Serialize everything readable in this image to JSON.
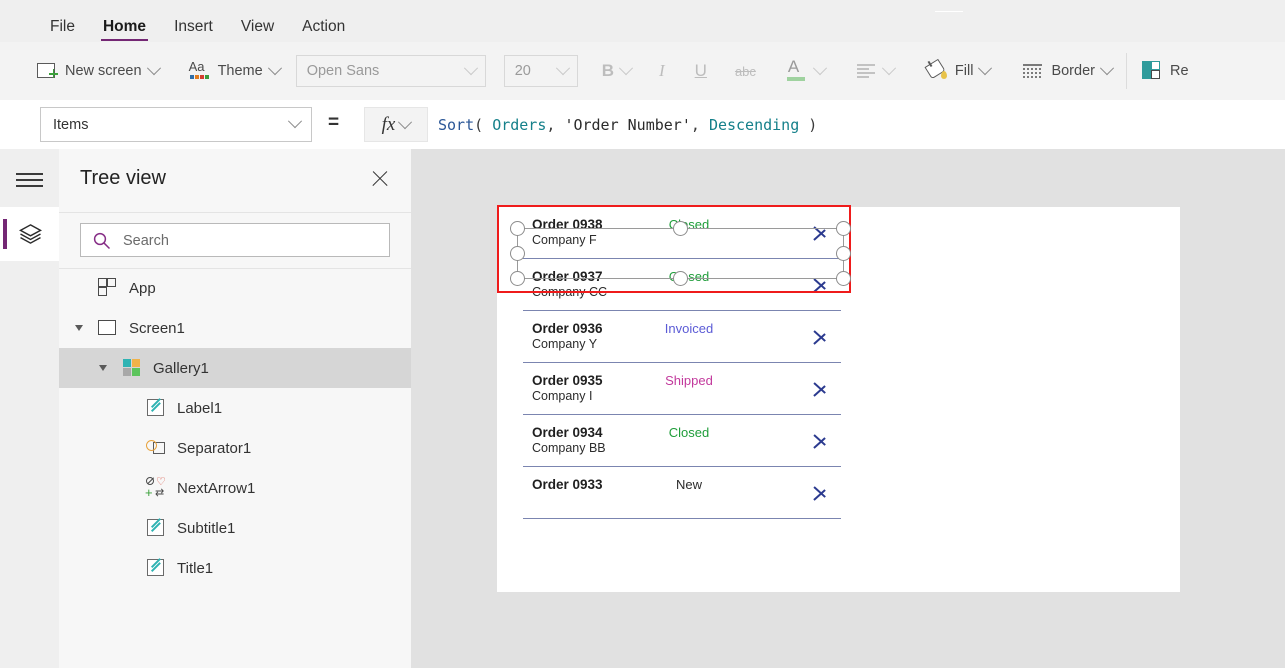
{
  "menubar": {
    "items": [
      {
        "label": "File",
        "active": false
      },
      {
        "label": "Home",
        "active": true
      },
      {
        "label": "Insert",
        "active": false
      },
      {
        "label": "View",
        "active": false
      },
      {
        "label": "Action",
        "active": false
      }
    ]
  },
  "ribbon": {
    "new_screen_label": "New screen",
    "theme_label": "Theme",
    "font_name": "Open Sans",
    "font_size": "20",
    "bold_label": "B",
    "italic_label": "I",
    "underline_label": "U",
    "strikethrough_label": "abc",
    "font_color_label": "A",
    "fill_label": "Fill",
    "border_label": "Border",
    "reorder_label": "Re"
  },
  "formula_bar": {
    "property": "Items",
    "equals": "=",
    "fx_label": "fx",
    "tokens": [
      {
        "text": "Sort",
        "kind": "fn"
      },
      {
        "text": "( ",
        "kind": "pun"
      },
      {
        "text": "Orders",
        "kind": "tbl"
      },
      {
        "text": ", ",
        "kind": "pun"
      },
      {
        "text": "'Order Number'",
        "kind": "str"
      },
      {
        "text": ", ",
        "kind": "pun"
      },
      {
        "text": "Descending",
        "kind": "enum"
      },
      {
        "text": " )",
        "kind": "pun"
      }
    ]
  },
  "tree_panel": {
    "title": "Tree view",
    "search_placeholder": "Search",
    "items": [
      {
        "label": "App",
        "icon": "app-icon",
        "indent": 38,
        "caret": false,
        "selected": false
      },
      {
        "label": "Screen1",
        "icon": "screen-icon",
        "indent": 38,
        "caret": true,
        "selected": false
      },
      {
        "label": "Gallery1",
        "icon": "gallery-icon",
        "indent": 62,
        "caret": true,
        "selected": true
      },
      {
        "label": "Label1",
        "icon": "label-icon",
        "indent": 86,
        "caret": false,
        "selected": false
      },
      {
        "label": "Separator1",
        "icon": "separator-icon",
        "indent": 86,
        "caret": false,
        "selected": false
      },
      {
        "label": "NextArrow1",
        "icon": "next-arrow-icon",
        "indent": 86,
        "caret": false,
        "selected": false
      },
      {
        "label": "Subtitle1",
        "icon": "label-icon",
        "indent": 86,
        "caret": false,
        "selected": false
      },
      {
        "label": "Title1",
        "icon": "label-icon",
        "indent": 86,
        "caret": false,
        "selected": false
      }
    ]
  },
  "colors": {
    "accent_purple": "#742774",
    "selection_red": "#ef1b1b",
    "status_closed": "#1f9d3a",
    "status_invoiced": "#5b5bd6",
    "status_shipped": "#c2399c",
    "status_new": "#2b2b2b",
    "chevron_blue": "#2b3a8f",
    "separator_line": "#7b85b0"
  },
  "gallery": {
    "selected_index": 0,
    "rows": [
      {
        "title": "Order 0938",
        "subtitle": "Company F",
        "status": "Closed",
        "status_color": "#1f9d3a"
      },
      {
        "title": "Order 0937",
        "subtitle": "Company CC",
        "status": "Closed",
        "status_color": "#1f9d3a"
      },
      {
        "title": "Order 0936",
        "subtitle": "Company Y",
        "status": "Invoiced",
        "status_color": "#5b5bd6"
      },
      {
        "title": "Order 0935",
        "subtitle": "Company I",
        "status": "Shipped",
        "status_color": "#c2399c"
      },
      {
        "title": "Order 0934",
        "subtitle": "Company BB",
        "status": "Closed",
        "status_color": "#1f9d3a"
      },
      {
        "title": "Order 0933",
        "subtitle": "",
        "status": "New",
        "status_color": "#2b2b2b"
      }
    ]
  }
}
